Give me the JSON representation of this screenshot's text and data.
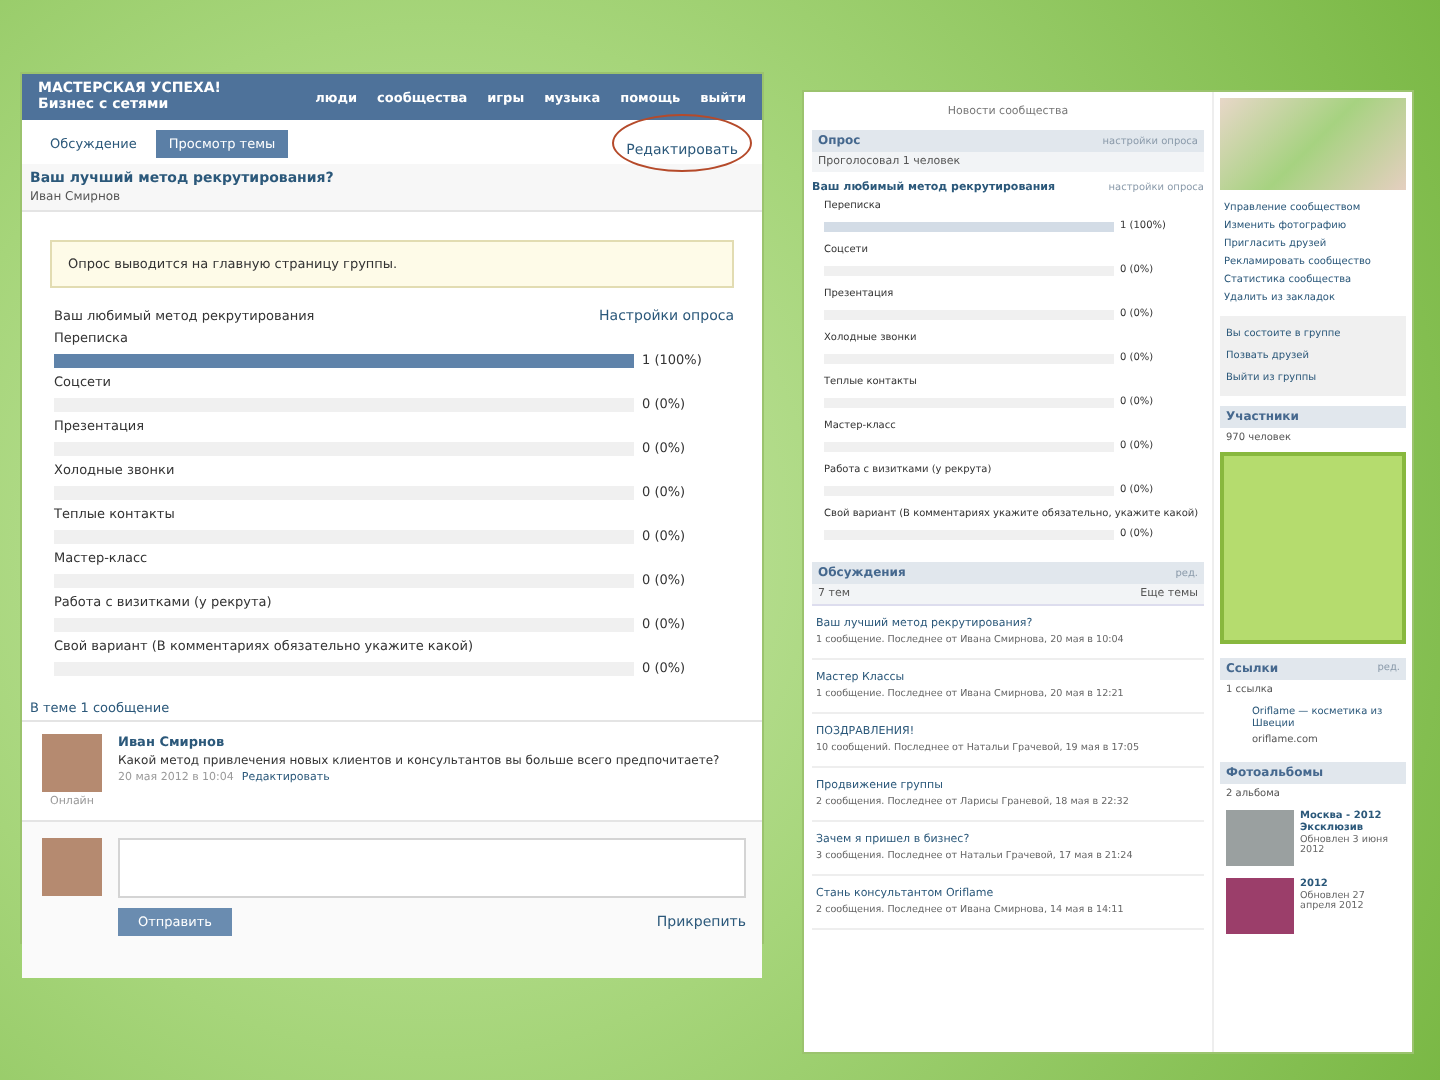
{
  "left": {
    "header": {
      "title": "МАСТЕРСКАЯ УСПЕХА! Бизнес с сетями",
      "nav": [
        "люди",
        "сообщества",
        "игры",
        "музыка",
        "помощь",
        "выйти"
      ]
    },
    "tabs": [
      {
        "label": "Обсуждение",
        "selected": false
      },
      {
        "label": "Просмотр темы",
        "selected": true
      }
    ],
    "edit_link": "Редактировать",
    "topic": {
      "title": "Ваш лучший метод рекрутирования?",
      "author": "Иван Смирнов"
    },
    "notice": "Опрос выводится на главную страницу группы.",
    "poll": {
      "title": "Ваш любимый метод рекрутирования",
      "settings": "Настройки опроса",
      "options": [
        {
          "label": "Переписка",
          "level": 1,
          "count": "1 (100%)"
        },
        {
          "label": "Соцсети",
          "level": 0,
          "count": "0 (0%)"
        },
        {
          "label": "Презентация",
          "level": 0,
          "count": "0 (0%)"
        },
        {
          "label": "Холодные звонки",
          "level": 0,
          "count": "0 (0%)"
        },
        {
          "label": "Теплые контакты",
          "level": 0,
          "count": "0 (0%)"
        },
        {
          "label": "Мастер-класс",
          "level": 0,
          "count": "0 (0%)"
        },
        {
          "label": "Работа с визитками (у рекрута)",
          "level": 0,
          "count": "0 (0%)"
        },
        {
          "label": "Свой вариант (В комментариях обязательно укажите какой)",
          "level": 0,
          "count": "0 (0%)"
        }
      ]
    },
    "thread_count": "В теме 1 сообщение",
    "post": {
      "author": "Иван Смирнов",
      "text": "Какой метод привлечения новых клиентов и консультантов вы больше всего предпочитаете?",
      "date": "20 мая 2012 в 10:04",
      "edit": "Редактировать",
      "status": "Онлайн"
    },
    "reply": {
      "send": "Отправить",
      "attach": "Прикрепить"
    }
  },
  "right": {
    "top_line": "Новости сообщества",
    "poll": {
      "header": "Опрос",
      "header_link": "настройки опроса",
      "voters": "Проголосовал 1 человек",
      "title": "Ваш любимый метод рекрутирования",
      "settings": "настройки опроса",
      "options": [
        {
          "label": "Переписка",
          "level": 1,
          "count": "1 (100%)"
        },
        {
          "label": "Соцсети",
          "level": 0,
          "count": "0 (0%)"
        },
        {
          "label": "Презентация",
          "level": 0,
          "count": "0 (0%)"
        },
        {
          "label": "Холодные звонки",
          "level": 0,
          "count": "0 (0%)"
        },
        {
          "label": "Теплые контакты",
          "level": 0,
          "count": "0 (0%)"
        },
        {
          "label": "Мастер-класс",
          "level": 0,
          "count": "0 (0%)"
        },
        {
          "label": "Работа с визитками (у рекрута)",
          "level": 0,
          "count": "0 (0%)"
        },
        {
          "label": "Свой вариант (В комментариях укажите обязательно, укажите какой)",
          "level": 0,
          "count": "0 (0%)"
        }
      ]
    },
    "discussions": {
      "header": "Обсуждения",
      "edit": "ред.",
      "count": "7 тем",
      "more": "Еще темы",
      "topics": [
        {
          "title": "Ваш лучший метод рекрутирования?",
          "meta": "1 сообщение. Последнее от Ивана Смирнова, 20 мая в 10:04"
        },
        {
          "title": "Мастер Классы",
          "meta": "1 сообщение. Последнее от Ивана Смирнова, 20 мая в 12:21"
        },
        {
          "title": "ПОЗДРАВЛЕНИЯ!",
          "meta": "10 сообщений. Последнее от Натальи Грачевой, 19 мая в 17:05"
        },
        {
          "title": "Продвижение группы",
          "meta": "2 сообщения. Последнее от Ларисы Граневой, 18 мая в 22:32"
        },
        {
          "title": "Зачем я пришел в бизнес?",
          "meta": "3 сообщения. Последнее от Натальи Грачевой, 17 мая в 21:24"
        },
        {
          "title": "Стань консультантом Oriflame",
          "meta": "2 сообщения. Последнее от Ивана Смирнова, 14 мая в 14:11"
        }
      ]
    },
    "sidebar": {
      "admin_links": [
        "Управление сообществом",
        "Изменить фотографию",
        "Пригласить друзей",
        "Рекламировать сообщество",
        "Статистика сообщества",
        "Удалить из закладок"
      ],
      "membership": [
        "Вы состоите в группе",
        "Позвать друзей",
        "Выйти из группы"
      ],
      "members": {
        "header": "Участники",
        "count": "970 человек"
      },
      "links": {
        "header": "Ссылки",
        "edit": "ред.",
        "count": "1 ссылка",
        "title": "Oriflame — косметика из Швеции",
        "url": "oriflame.com"
      },
      "albums": {
        "header": "Фотоальбомы",
        "count": "2 альбома",
        "items": [
          {
            "title": "Москва - 2012 Эксклюзив",
            "date": "Обновлен 3 июня 2012"
          },
          {
            "title": "2012",
            "date": "Обновлен 27 апреля 2012"
          }
        ]
      }
    }
  }
}
